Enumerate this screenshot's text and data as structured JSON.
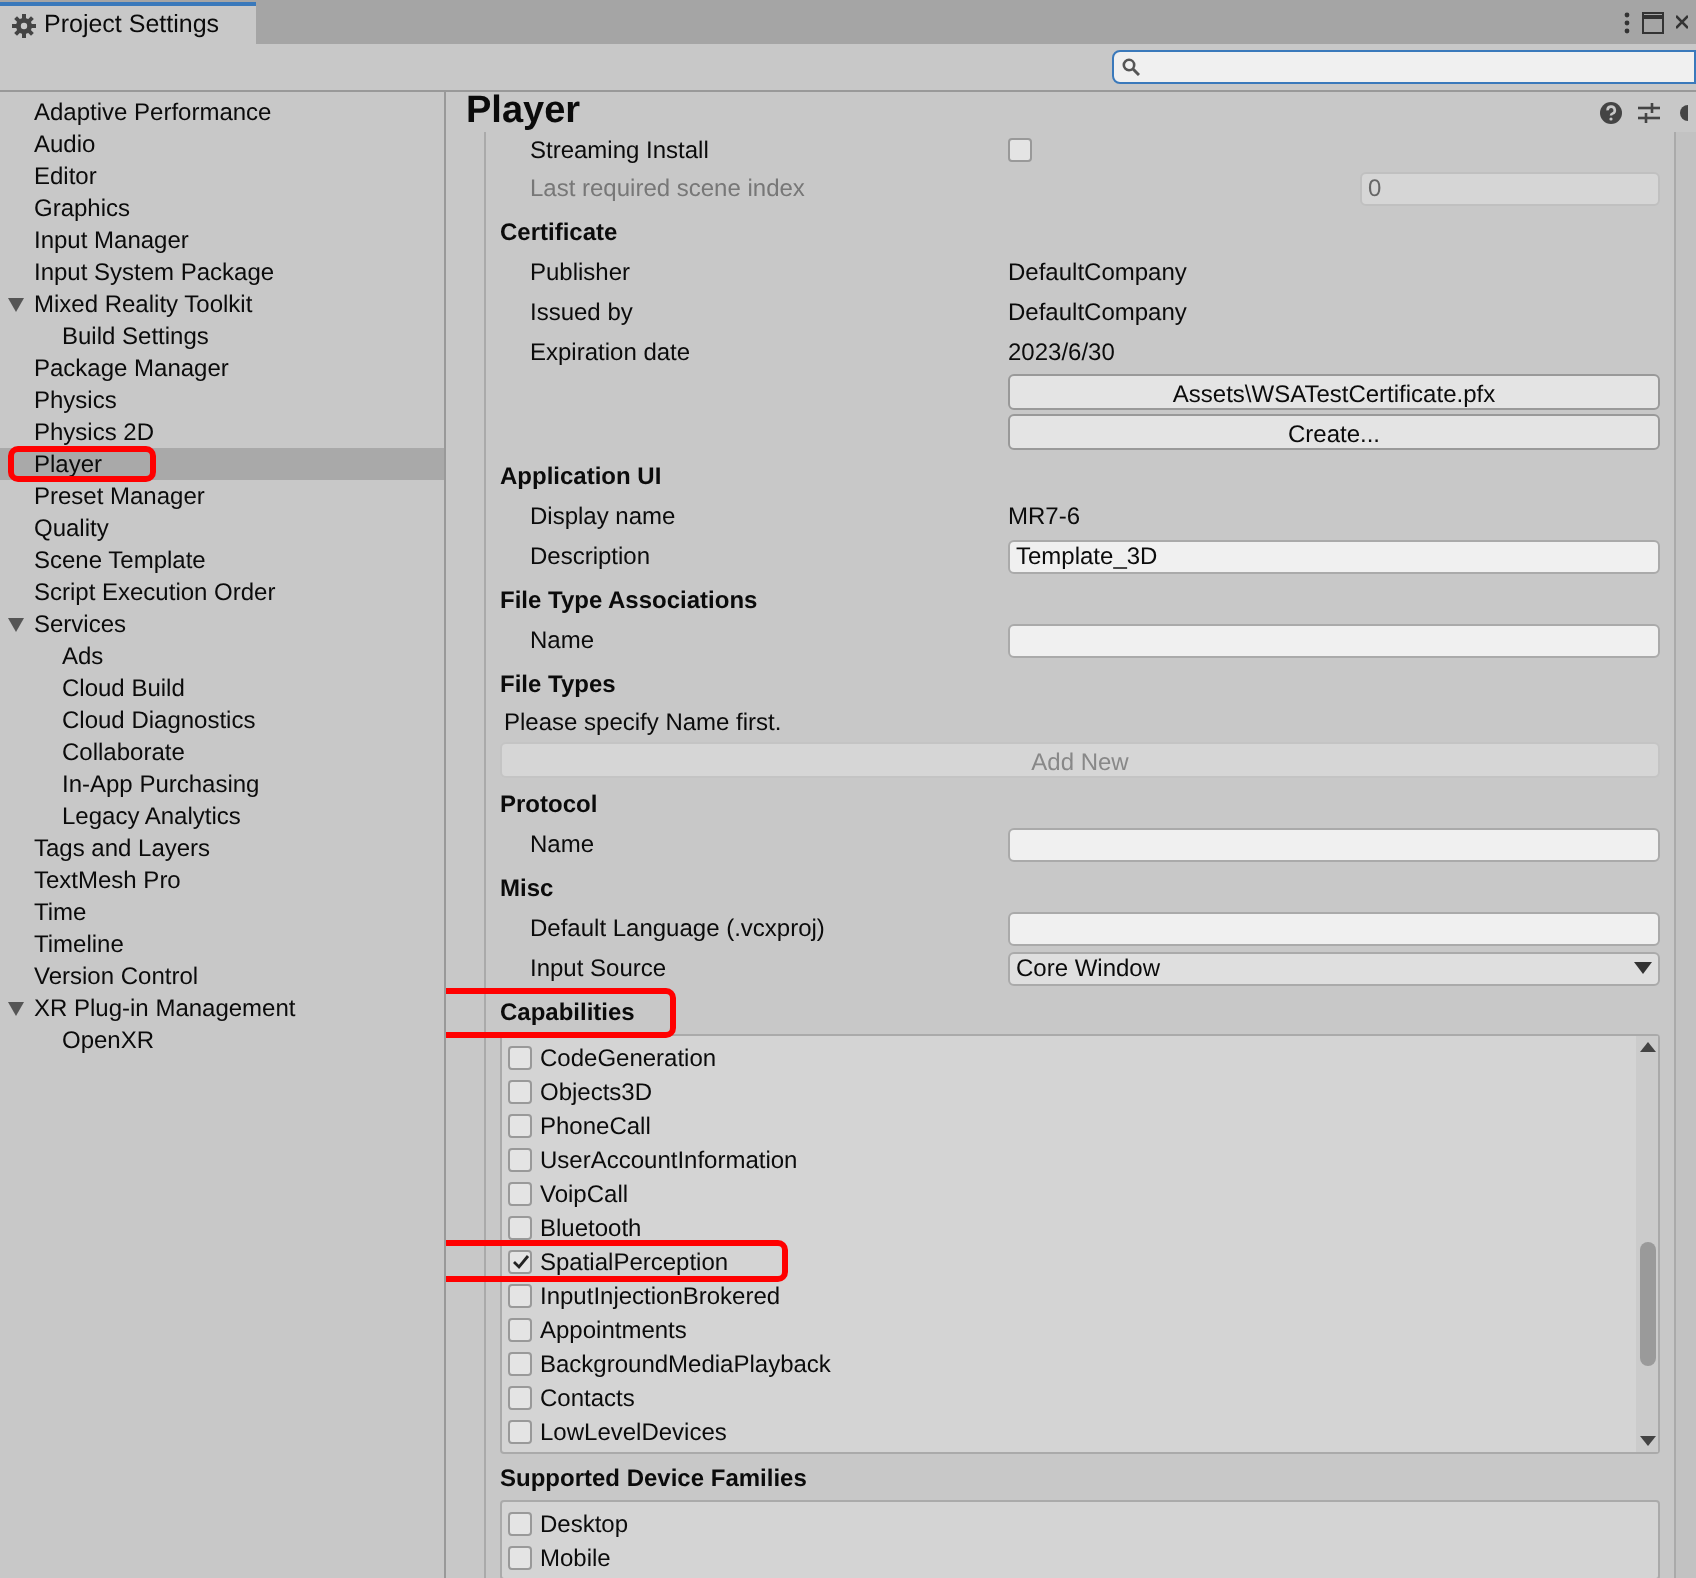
{
  "window": {
    "title": "Project Settings"
  },
  "sidebar": {
    "items": [
      {
        "label": "Adaptive Performance",
        "selected": false,
        "highlighted": false
      },
      {
        "label": "Audio",
        "selected": false,
        "highlighted": false
      },
      {
        "label": "Editor",
        "selected": false,
        "highlighted": false
      },
      {
        "label": "Graphics",
        "selected": false,
        "highlighted": false
      },
      {
        "label": "Input Manager",
        "selected": false,
        "highlighted": false
      },
      {
        "label": "Input System Package",
        "selected": false,
        "highlighted": false
      },
      {
        "label": "Mixed Reality Toolkit",
        "selected": false,
        "highlighted": false,
        "expanded": true,
        "children": [
          {
            "label": "Build Settings",
            "selected": false,
            "highlighted": false
          }
        ]
      },
      {
        "label": "Package Manager",
        "selected": false,
        "highlighted": false
      },
      {
        "label": "Physics",
        "selected": false,
        "highlighted": false
      },
      {
        "label": "Physics 2D",
        "selected": false,
        "highlighted": false
      },
      {
        "label": "Player",
        "selected": true,
        "highlighted": true
      },
      {
        "label": "Preset Manager",
        "selected": false,
        "highlighted": false
      },
      {
        "label": "Quality",
        "selected": false,
        "highlighted": false
      },
      {
        "label": "Scene Template",
        "selected": false,
        "highlighted": false
      },
      {
        "label": "Script Execution Order",
        "selected": false,
        "highlighted": false
      },
      {
        "label": "Services",
        "selected": false,
        "highlighted": false,
        "expanded": true,
        "children": [
          {
            "label": "Ads",
            "selected": false,
            "highlighted": false
          },
          {
            "label": "Cloud Build",
            "selected": false,
            "highlighted": false
          },
          {
            "label": "Cloud Diagnostics",
            "selected": false,
            "highlighted": false
          },
          {
            "label": "Collaborate",
            "selected": false,
            "highlighted": false
          },
          {
            "label": "In-App Purchasing",
            "selected": false,
            "highlighted": false
          },
          {
            "label": "Legacy Analytics",
            "selected": false,
            "highlighted": false
          }
        ]
      },
      {
        "label": "Tags and Layers",
        "selected": false,
        "highlighted": false
      },
      {
        "label": "TextMesh Pro",
        "selected": false,
        "highlighted": false
      },
      {
        "label": "Time",
        "selected": false,
        "highlighted": false
      },
      {
        "label": "Timeline",
        "selected": false,
        "highlighted": false
      },
      {
        "label": "Version Control",
        "selected": false,
        "highlighted": false
      },
      {
        "label": "XR Plug-in Management",
        "selected": false,
        "highlighted": false,
        "expanded": true,
        "children": [
          {
            "label": "OpenXR",
            "selected": false,
            "highlighted": false
          }
        ]
      }
    ]
  },
  "inspector": {
    "title": "Player",
    "rows": [
      {
        "kind": "toggle",
        "label": "Streaming Install",
        "checked": false
      },
      {
        "kind": "input",
        "label": "Last required scene index",
        "value": "0",
        "disabled": true
      },
      {
        "kind": "header",
        "label": "Certificate",
        "highlighted": false
      },
      {
        "kind": "text",
        "label": "Publisher",
        "value": "DefaultCompany"
      },
      {
        "kind": "text",
        "label": "Issued by",
        "value": "DefaultCompany"
      },
      {
        "kind": "text",
        "label": "Expiration date",
        "value": "2023/6/30"
      },
      {
        "kind": "button",
        "value": "Assets\\WSATestCertificate.pfx"
      },
      {
        "kind": "button",
        "value": "Create..."
      },
      {
        "kind": "header",
        "label": "Application UI",
        "highlighted": false
      },
      {
        "kind": "text",
        "label": "Display name",
        "value": "MR7-6"
      },
      {
        "kind": "input",
        "label": "Description",
        "value": "Template_3D",
        "disabled": false
      },
      {
        "kind": "header",
        "label": "File Type Associations",
        "highlighted": false
      },
      {
        "kind": "input",
        "label": "Name",
        "disabled": false
      },
      {
        "kind": "header",
        "label": "File Types",
        "highlighted": false
      },
      {
        "kind": "note",
        "label": "Please specify Name first."
      },
      {
        "kind": "widebutton",
        "value": "Add New",
        "disabled": true
      },
      {
        "kind": "header",
        "label": "Protocol",
        "highlighted": false
      },
      {
        "kind": "input",
        "label": "Name",
        "disabled": false
      },
      {
        "kind": "header",
        "label": "Misc",
        "highlighted": false
      },
      {
        "kind": "input",
        "label": "Default Language (.vcxproj)",
        "disabled": false
      },
      {
        "kind": "dropdown",
        "label": "Input Source",
        "value": "Core Window"
      },
      {
        "kind": "header",
        "label": "Capabilities",
        "highlighted": true
      },
      {
        "kind": "checklist",
        "scroll": true,
        "items": [
          {
            "label": "CodeGeneration",
            "checked": false,
            "highlighted": false
          },
          {
            "label": "Objects3D",
            "checked": false,
            "highlighted": false
          },
          {
            "label": "PhoneCall",
            "checked": false,
            "highlighted": false
          },
          {
            "label": "UserAccountInformation",
            "checked": false,
            "highlighted": false
          },
          {
            "label": "VoipCall",
            "checked": false,
            "highlighted": false
          },
          {
            "label": "Bluetooth",
            "checked": false,
            "highlighted": false
          },
          {
            "label": "SpatialPerception",
            "checked": true,
            "highlighted": true
          },
          {
            "label": "InputInjectionBrokered",
            "checked": false,
            "highlighted": false
          },
          {
            "label": "Appointments",
            "checked": false,
            "highlighted": false
          },
          {
            "label": "BackgroundMediaPlayback",
            "checked": false,
            "highlighted": false
          },
          {
            "label": "Contacts",
            "checked": false,
            "highlighted": false
          },
          {
            "label": "LowLevelDevices",
            "checked": false,
            "highlighted": false
          }
        ]
      },
      {
        "kind": "header",
        "label": "Supported Device Families",
        "highlighted": false
      },
      {
        "kind": "checklist",
        "scroll": false,
        "items": [
          {
            "label": "Desktop",
            "checked": false,
            "highlighted": false
          },
          {
            "label": "Mobile",
            "checked": false,
            "highlighted": false
          }
        ]
      }
    ]
  }
}
